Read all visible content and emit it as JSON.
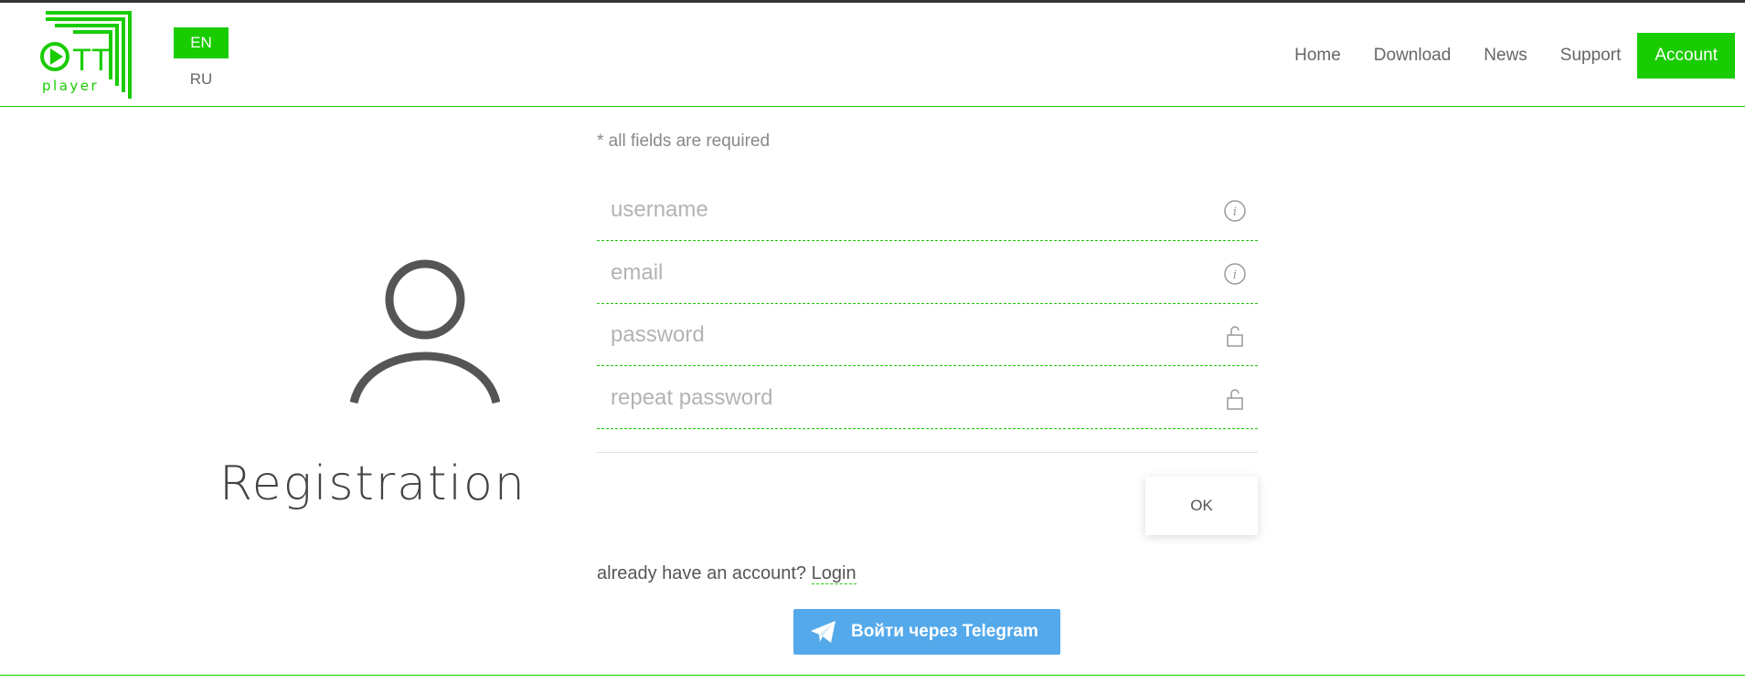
{
  "brand": {
    "logo_text": "player",
    "logo_letters": "TT"
  },
  "languages": {
    "en": "EN",
    "ru": "RU"
  },
  "nav": [
    {
      "label": "Home"
    },
    {
      "label": "Download"
    },
    {
      "label": "News"
    },
    {
      "label": "Support"
    },
    {
      "label": "Account",
      "active": true
    }
  ],
  "page": {
    "title": "Registration"
  },
  "form": {
    "required_note": "* all fields are required",
    "fields": [
      {
        "placeholder": "username",
        "value": "",
        "icon": "info-icon"
      },
      {
        "placeholder": "email",
        "value": "",
        "icon": "info-icon"
      },
      {
        "placeholder": "password",
        "value": "",
        "icon": "unlock-icon"
      },
      {
        "placeholder": "repeat password",
        "value": "",
        "icon": "unlock-icon"
      }
    ],
    "submit_label": "OK",
    "have_account_text": "already have an account?",
    "login_label": "Login",
    "telegram_label": "Войти через Telegram"
  },
  "colors": {
    "accent": "#19cc00",
    "telegram": "#54a9eb",
    "text": "#555555"
  }
}
